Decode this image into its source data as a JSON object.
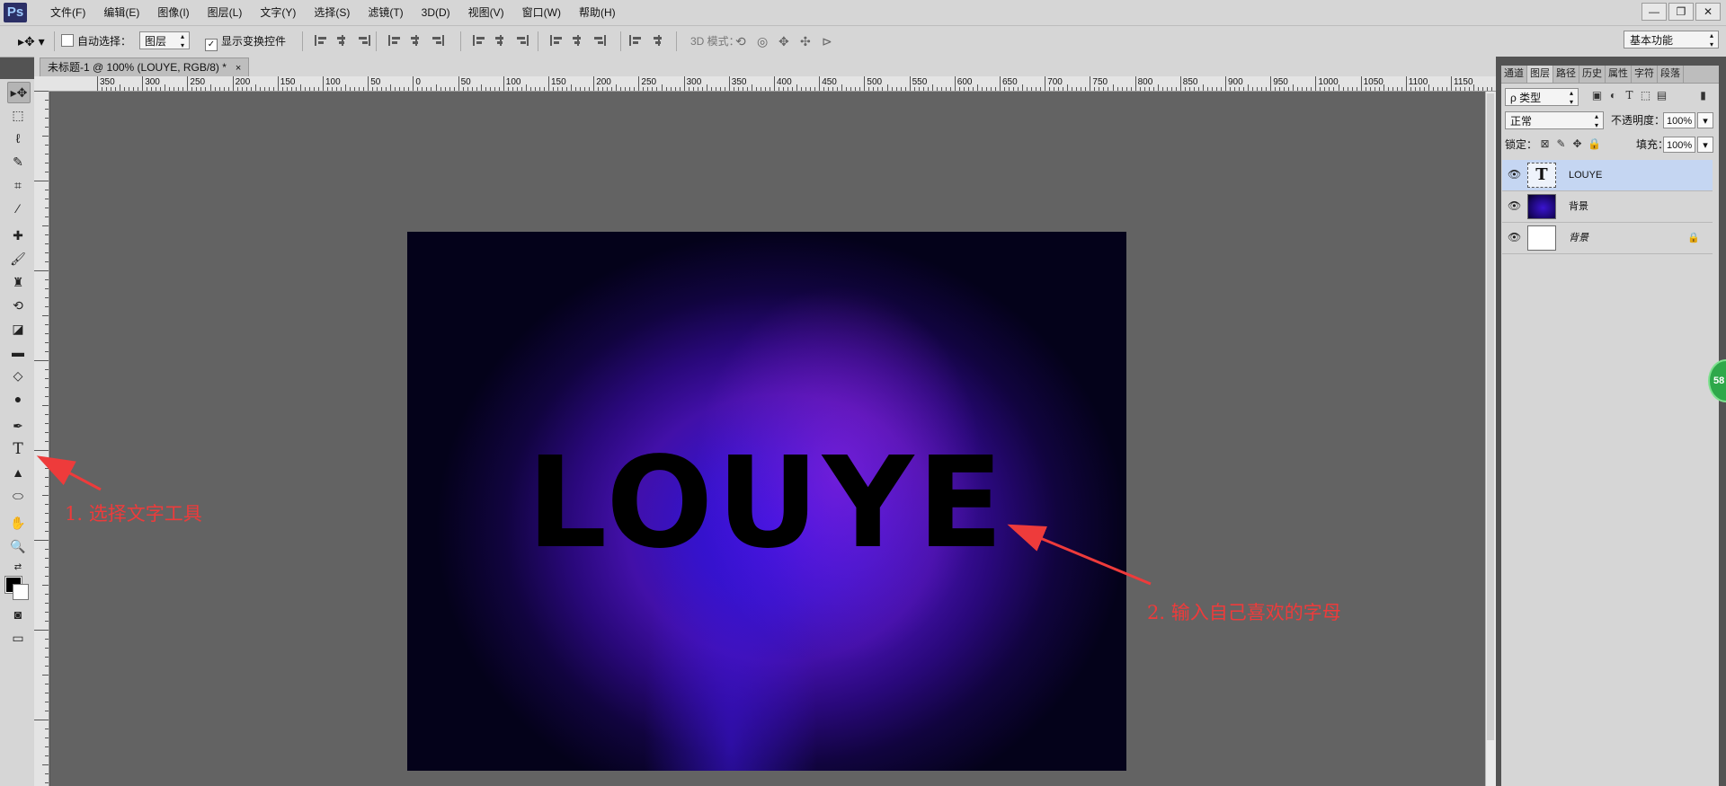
{
  "app": {
    "logo": "Ps"
  },
  "menu": [
    "文件(F)",
    "编辑(E)",
    "图像(I)",
    "图层(L)",
    "文字(Y)",
    "选择(S)",
    "滤镜(T)",
    "3D(D)",
    "视图(V)",
    "窗口(W)",
    "帮助(H)"
  ],
  "window_controls": {
    "minimize": "—",
    "restore": "❐",
    "close": "✕"
  },
  "options_bar": {
    "auto_select_label": "自动选择：",
    "auto_select_target": "图层",
    "show_transform_label": "显示变换控件",
    "mode_3d_label": "3D 模式：",
    "workspace": "基本功能"
  },
  "document": {
    "tab_title": "未标题-1 @ 100% (LOUYE, RGB/8) *",
    "tab_close": "×",
    "canvas_text": "LOUYE"
  },
  "ruler_h_labels": [
    "350",
    "300",
    "250",
    "200",
    "150",
    "100",
    "50",
    "0",
    "50",
    "100",
    "150",
    "200",
    "250",
    "300",
    "350",
    "400",
    "450",
    "500",
    "550",
    "600",
    "650",
    "700",
    "750",
    "800",
    "850",
    "900",
    "950",
    "1000",
    "1050",
    "1100",
    "1150"
  ],
  "annotations": {
    "step1": "1. 选择文字工具",
    "step2": "2. 输入自己喜欢的字母"
  },
  "panel": {
    "tabs": [
      "通道",
      "图层",
      "路径",
      "历史",
      "属性",
      "字符",
      "段落"
    ],
    "active_tab": "图层",
    "filter_kind": "ρ 类型",
    "blend_mode": "正常",
    "opacity_label": "不透明度：",
    "opacity_value": "100%",
    "lock_label": "锁定：",
    "fill_label": "填充：",
    "fill_value": "100%"
  },
  "layers": [
    {
      "name": "LOUYE",
      "kind": "text",
      "selected": true
    },
    {
      "name": "背景",
      "kind": "image",
      "selected": false
    },
    {
      "name": "背景",
      "kind": "background",
      "selected": false,
      "locked": true
    }
  ],
  "badge": {
    "text": "58"
  },
  "colors": {
    "accent_annotation": "#ee3b3b",
    "selected_layer": "#c5d6f2",
    "canvas_purple": "#3412c8"
  }
}
